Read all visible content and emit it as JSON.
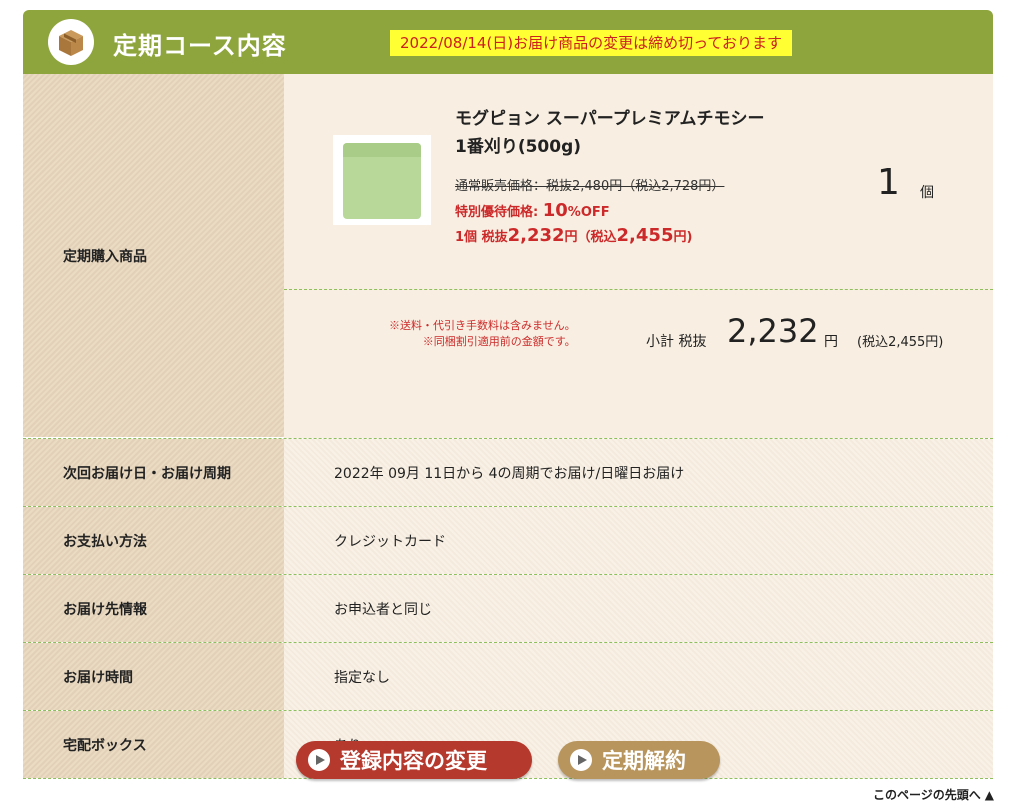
{
  "header": {
    "title": "定期コース内容",
    "deadline_notice": "2022/08/14(日)お届け商品の変更は締め切っております"
  },
  "product": {
    "row_label": "定期購入商品",
    "name_line1": "モグピョン スーパープレミアムチモシー",
    "name_line2": "1番刈り(500g)",
    "regular_price": "通常販売価格：税抜2,480円（税込2,728円）",
    "special_label": "特別優待価格: ",
    "special_discount": "10",
    "special_suffix": "%OFF",
    "unit_prefix": "1個 税抜",
    "unit_tax_excl": "2,232",
    "unit_mid": "円（税込",
    "unit_tax_incl": "2,455",
    "unit_end": "円)",
    "quantity": "1",
    "quantity_unit": "個",
    "note_line1": "※送料・代引き手数料は含みません。",
    "note_line2": "※同梱割引適用前の金額です。",
    "subtotal_label": "小計 税抜",
    "subtotal_value": "2,232",
    "subtotal_unit": "円",
    "subtotal_tax": "(税込2,455円)"
  },
  "rows": [
    {
      "label": "次回お届け日・お届け周期",
      "value": "2022年 09月 11日から 4の周期でお届け/日曜日お届け"
    },
    {
      "label": "お支払い方法",
      "value": "クレジットカード"
    },
    {
      "label": "お届け先情報",
      "value": "お申込者と同じ"
    },
    {
      "label": "お届け時間",
      "value": "指定なし"
    },
    {
      "label": "宅配ボックス",
      "value": "あり"
    }
  ],
  "buttons": {
    "edit": "登録内容の変更",
    "cancel": "定期解約"
  },
  "footer": {
    "to_top": "このページの先頭へ"
  },
  "colors": {
    "header_bg": "#8ea53d",
    "notice_bg": "#ffff33",
    "notice_text": "#cc1f1f",
    "edit_button": "#b6392e",
    "cancel_button": "#b8955d"
  }
}
